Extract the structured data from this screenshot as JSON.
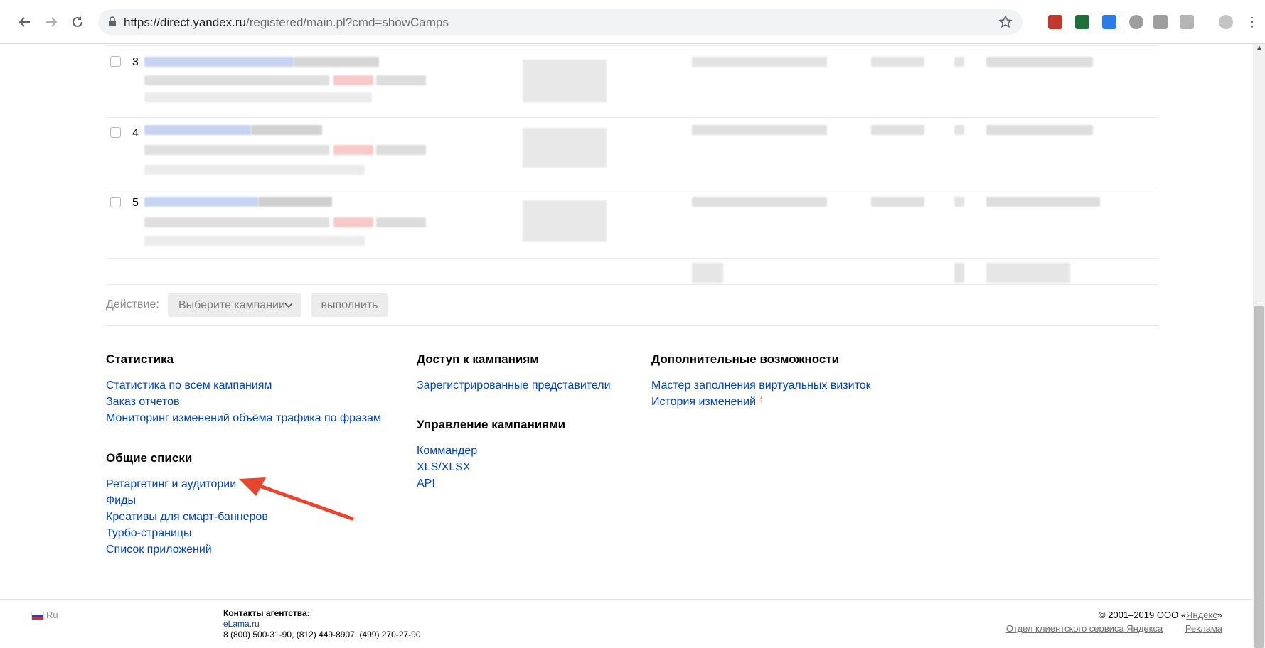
{
  "browser": {
    "url_host": "https://direct.yandex.ru",
    "url_path": "/registered/main.pl?cmd=showCamps"
  },
  "table": {
    "rows": [
      {
        "num": "3"
      },
      {
        "num": "4"
      },
      {
        "num": "5"
      }
    ]
  },
  "actions": {
    "label": "Действие:",
    "select_value": "Выберите кампании",
    "run_label": "выполнить"
  },
  "sections": {
    "stats": {
      "title": "Статистика",
      "links": [
        "Статистика по всем кампаниям",
        "Заказ отчетов",
        "Мониторинг изменений объёма трафика по фразам"
      ]
    },
    "lists": {
      "title": "Общие списки",
      "links": [
        "Ретаргетинг и аудитории",
        "Фиды",
        "Креативы для смарт-баннеров",
        "Турбо-страницы",
        "Список приложений"
      ]
    },
    "access": {
      "title": "Доступ к кампаниям",
      "links": [
        "Зарегистрированные представители"
      ]
    },
    "manage": {
      "title": "Управление кампаниями",
      "links": [
        "Коммандер",
        "XLS/XLSX",
        "API"
      ]
    },
    "extra": {
      "title": "Дополнительные возможности",
      "links": [
        "Мастер заполнения виртуальных визиток",
        "История изменений"
      ],
      "beta": "β"
    }
  },
  "footer": {
    "lang": "Ru",
    "contacts_title": "Контакты агентства:",
    "contacts_site": "eLama.ru",
    "contacts_phones": "8 (800) 500-31-90, (812) 449-8907, (499) 270-27-90",
    "copyright_prefix": "© 2001–2019 ООО «",
    "copyright_link": "Яндекс",
    "copyright_suffix": "»",
    "link_service": "Отдел клиентского сервиса Яндекса",
    "link_ads": "Реклама"
  },
  "colors": {
    "link": "#0044bb",
    "arrow": "#e8452f",
    "beta": "#e8522f"
  }
}
